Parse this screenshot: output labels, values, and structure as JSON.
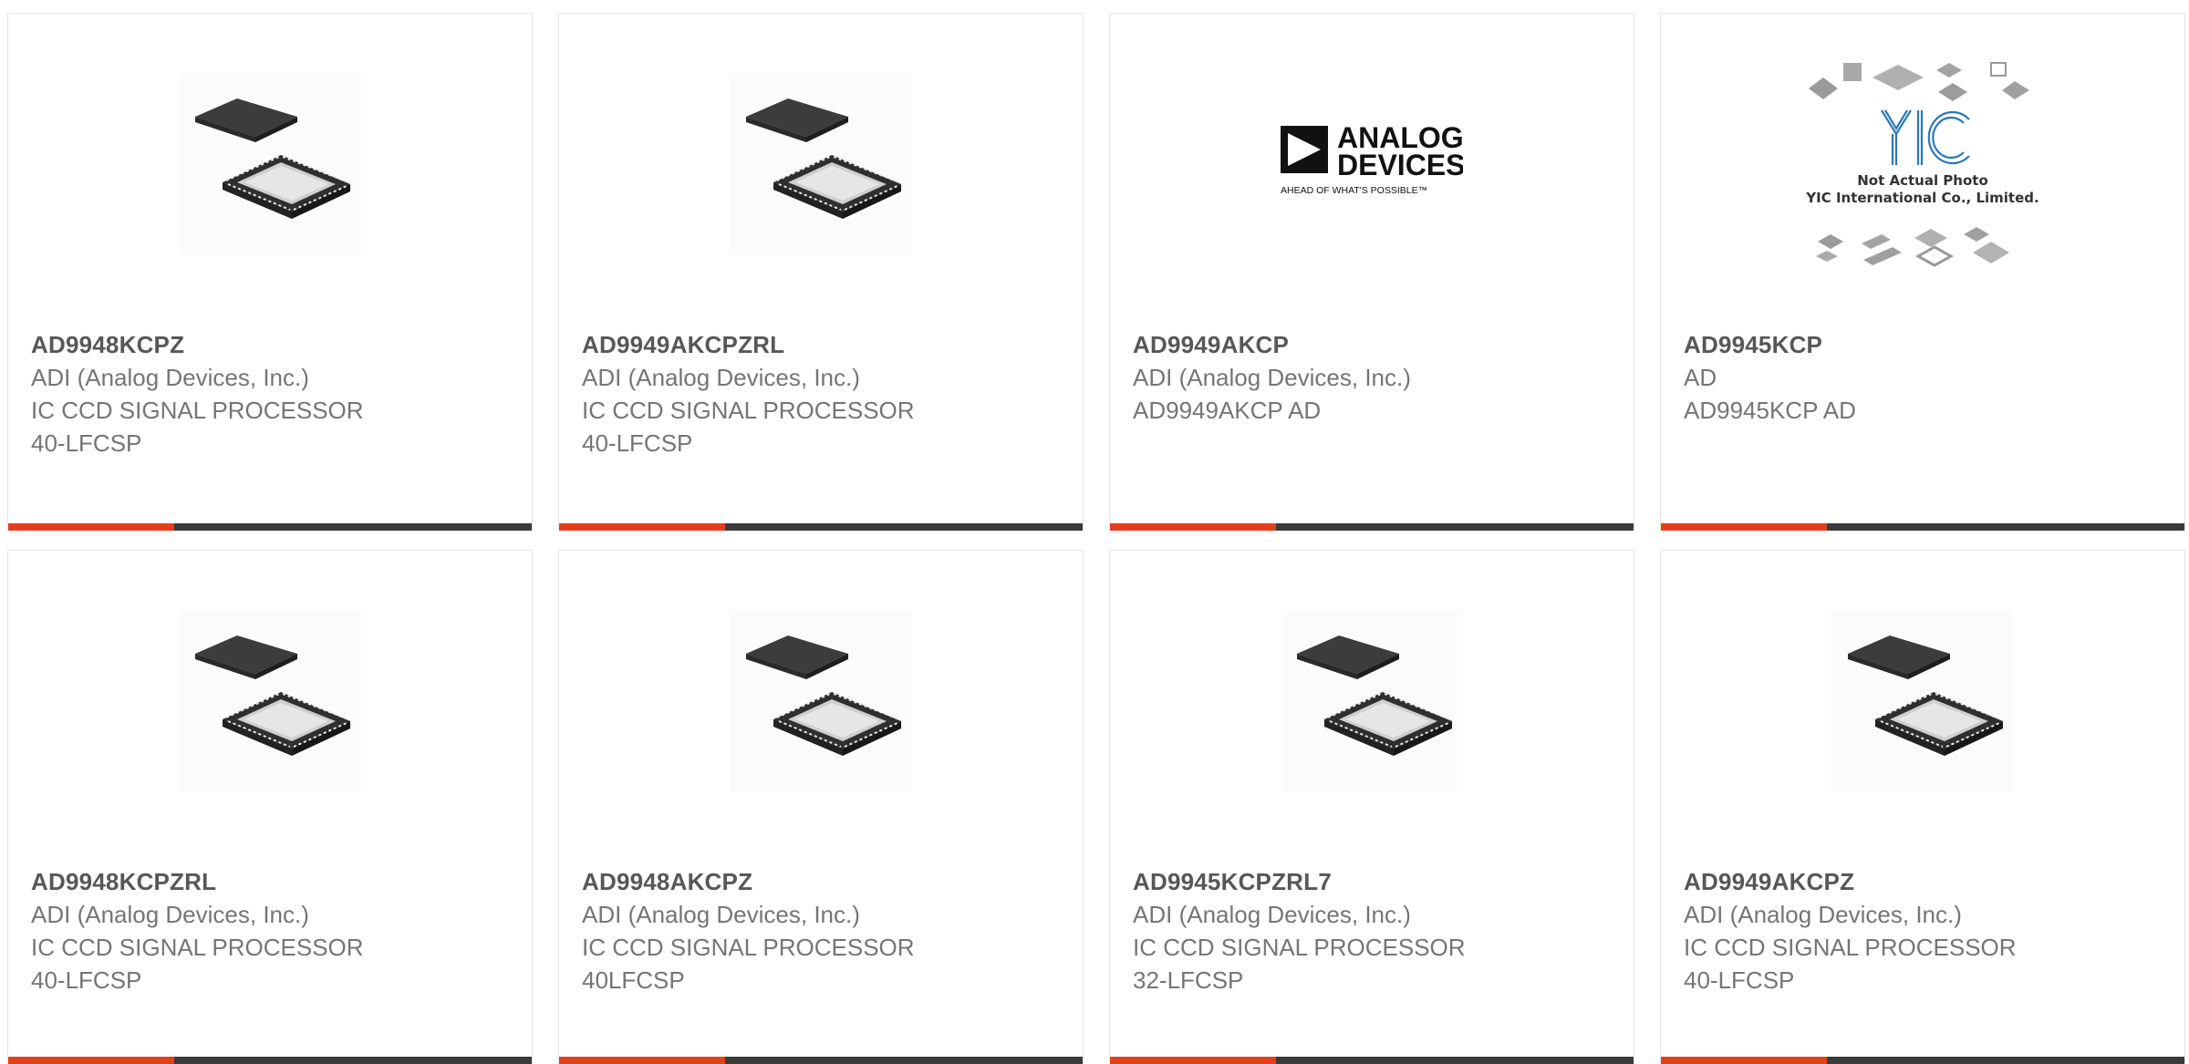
{
  "colors": {
    "accent": "#e2401c",
    "bar": "#3a3a3a"
  },
  "products": [
    {
      "part": "AD9948KCPZ",
      "manufacturer": "ADI (Analog Devices, Inc.)",
      "desc": "IC CCD SIGNAL PROCESSOR",
      "pkg": "40-LFCSP",
      "image": "chip-package-image"
    },
    {
      "part": "AD9949AKCPZRL",
      "manufacturer": "ADI (Analog Devices, Inc.)",
      "desc": "IC CCD SIGNAL PROCESSOR",
      "pkg": "40-LFCSP",
      "image": "chip-package-image"
    },
    {
      "part": "AD9949AKCP",
      "manufacturer": "ADI (Analog Devices, Inc.)",
      "desc": "AD9949AKCP AD",
      "pkg": "",
      "image": "analog-devices-logo",
      "logo": {
        "line1": "ANALOG",
        "line2": "DEVICES",
        "tagline": "AHEAD OF WHAT'S POSSIBLE™"
      }
    },
    {
      "part": "AD9945KCP",
      "manufacturer": "AD",
      "desc": "AD9945KCP AD",
      "pkg": "",
      "image": "yic-placeholder-image",
      "placeholder": {
        "line1": "Not Actual Photo",
        "line2": "YIC International Co., Limited."
      }
    },
    {
      "part": "AD9948KCPZRL",
      "manufacturer": "ADI (Analog Devices, Inc.)",
      "desc": "IC CCD SIGNAL PROCESSOR",
      "pkg": "40-LFCSP",
      "image": "chip-package-image"
    },
    {
      "part": "AD9948AKCPZ",
      "manufacturer": "ADI (Analog Devices, Inc.)",
      "desc": "IC CCD SIGNAL PROCESSOR",
      "pkg": "40LFCSP",
      "image": "chip-package-image"
    },
    {
      "part": "AD9945KCPZRL7",
      "manufacturer": "ADI (Analog Devices, Inc.)",
      "desc": "IC CCD SIGNAL PROCESSOR",
      "pkg": "32-LFCSP",
      "image": "chip-package-image"
    },
    {
      "part": "AD9949AKCPZ",
      "manufacturer": "ADI (Analog Devices, Inc.)",
      "desc": "IC CCD SIGNAL PROCESSOR",
      "pkg": "40-LFCSP",
      "image": "chip-package-image"
    }
  ]
}
